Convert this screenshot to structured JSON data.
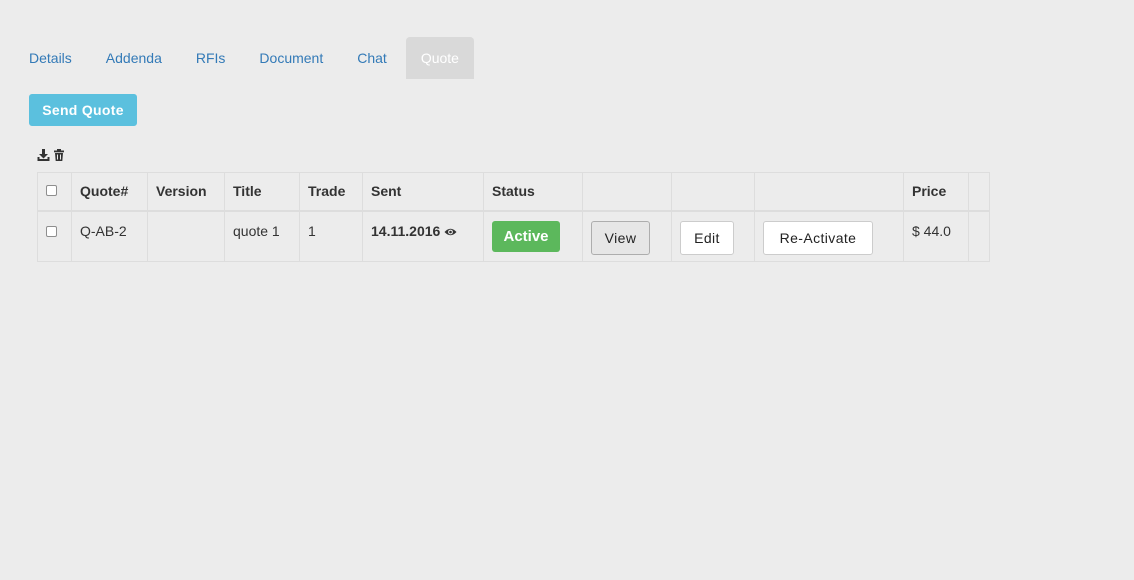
{
  "tabs": [
    {
      "label": "Details",
      "active": false
    },
    {
      "label": "Addenda",
      "active": false
    },
    {
      "label": "RFIs",
      "active": false
    },
    {
      "label": "Document",
      "active": false
    },
    {
      "label": "Chat",
      "active": false
    },
    {
      "label": "Quote",
      "active": true
    }
  ],
  "send_quote_label": "Send Quote",
  "toolbar": {
    "icons": [
      "download-icon",
      "trash-icon"
    ]
  },
  "table": {
    "headers": {
      "quote_num": "Quote#",
      "version": "Version",
      "title": "Title",
      "trade": "Trade",
      "sent": "Sent",
      "status": "Status",
      "price": "Price"
    },
    "rows": [
      {
        "quote_num": "Q-AB-2",
        "version": "",
        "title": "quote 1",
        "trade": "1",
        "sent": "14.11.2016",
        "status": "Active",
        "view_label": "View",
        "edit_label": "Edit",
        "reactivate_label": "Re-Activate",
        "price": "$ 44.0"
      }
    ]
  },
  "colors": {
    "background": "#ececec",
    "link": "#337ab7",
    "info_button": "#5bc0de",
    "success_badge": "#5cb85c",
    "active_tab": "#d9d9d9"
  }
}
